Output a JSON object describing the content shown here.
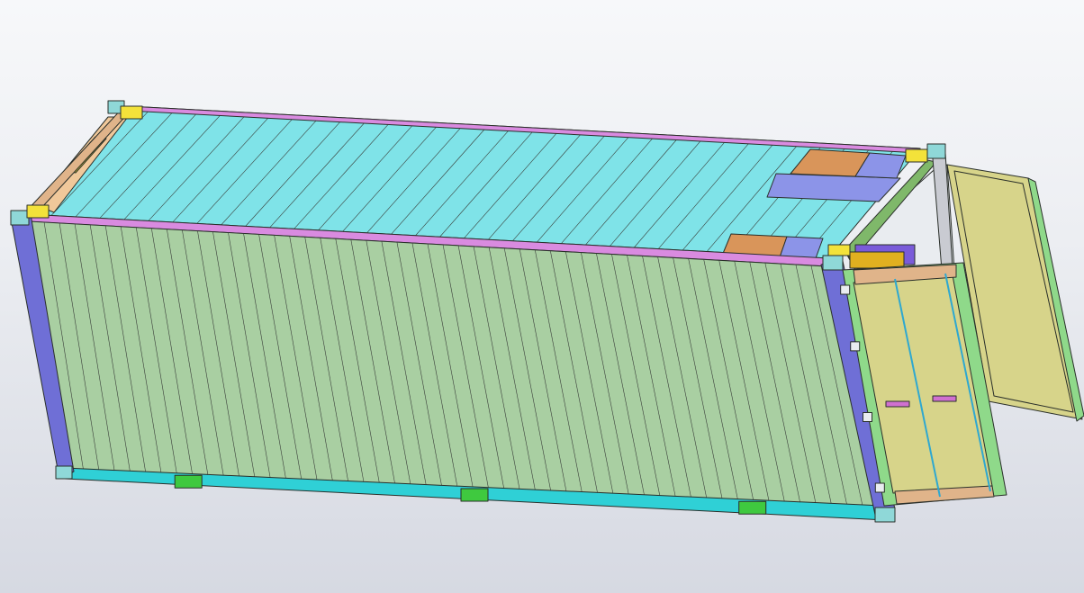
{
  "viewport": {
    "background_top": "#f7f8fa",
    "background_bottom": "#d6d9e2"
  },
  "model": {
    "colors": {
      "roof": "#7fe3e8",
      "side_wall": "#a9cfa2",
      "corner_post": "#6f6fd6",
      "top_rail": "#d98be0",
      "bottom_rail": "#2fd0d6",
      "forklift_pocket": "#3fc93f",
      "corner_casting": "#f3e23a",
      "door_frame": "#8fd98a",
      "door_panel": "#d7d48a",
      "door_header_sill": "#e0b48a",
      "roof_pads_orange": "#d9955a",
      "roof_pads_blue": "#8c94e8",
      "interior_wall": "#7fb86a"
    },
    "roof_corrugations": 33,
    "side_corrugations": 52,
    "forklift_pockets": 3,
    "door_lock_rods": 2,
    "icons": [
      "corner-casting-icon",
      "forklift-pocket-icon",
      "lock-rod-icon",
      "door-hinge-icon"
    ]
  }
}
